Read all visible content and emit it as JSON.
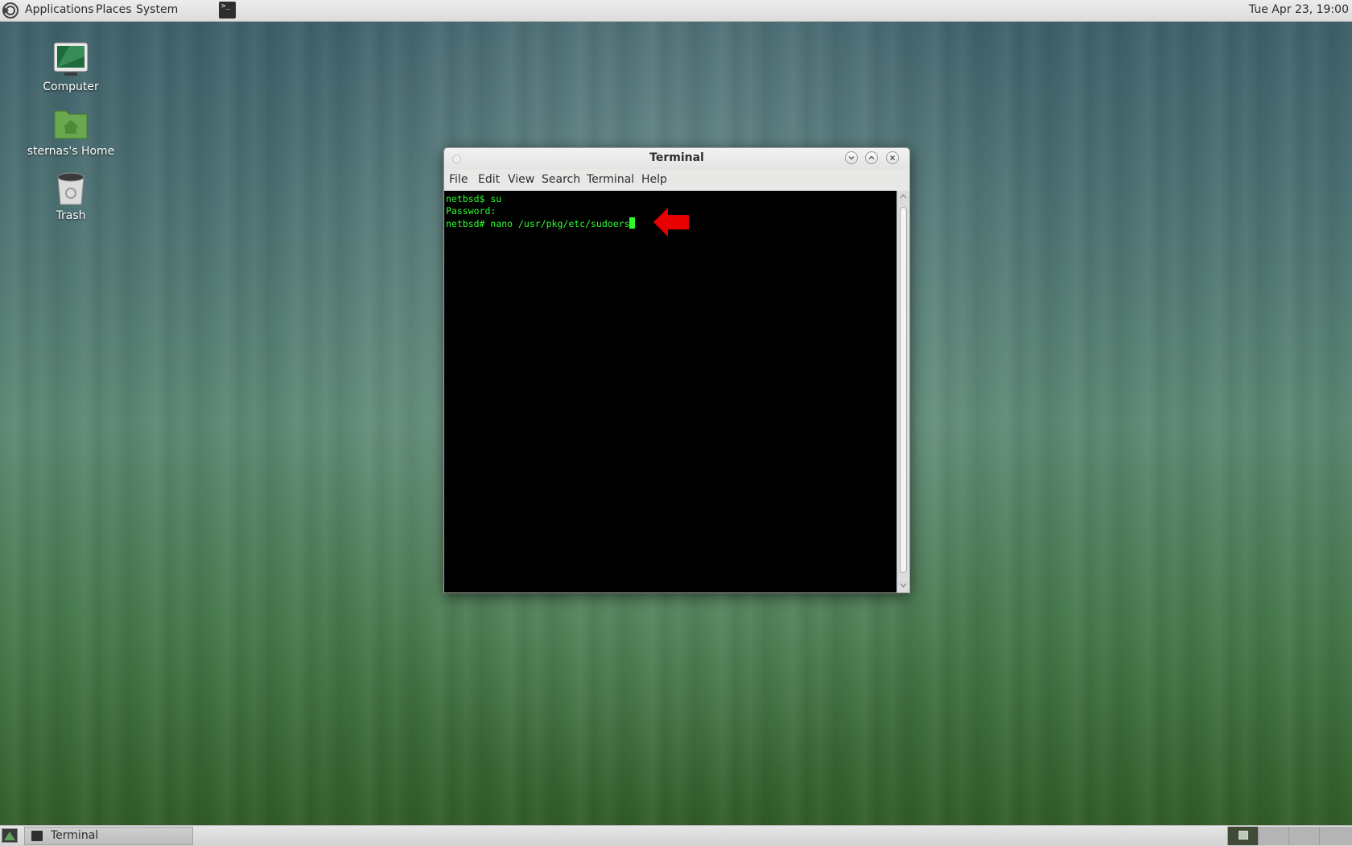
{
  "top_panel": {
    "menus": [
      "Applications",
      "Places",
      "System"
    ],
    "clock": "Tue Apr 23, 19:00",
    "launcher_icon": "terminal-launcher-icon",
    "logo_icon": "netbsd-logo-icon"
  },
  "desktop": {
    "icons": [
      {
        "label": "Computer",
        "icon": "computer-icon"
      },
      {
        "label": "sternas's Home",
        "icon": "home-folder-icon"
      },
      {
        "label": "Trash",
        "icon": "trash-icon"
      }
    ]
  },
  "window": {
    "title": "Terminal",
    "menu": [
      "File",
      "Edit",
      "View",
      "Search",
      "Terminal",
      "Help"
    ],
    "lines": [
      "netbsd$ su",
      "Password:",
      "netbsd# nano /usr/pkg/etc/sudoers"
    ],
    "text_color": "#2cff2c",
    "annotation_color": "#e60000"
  },
  "taskbar": {
    "task_label": "Terminal"
  }
}
